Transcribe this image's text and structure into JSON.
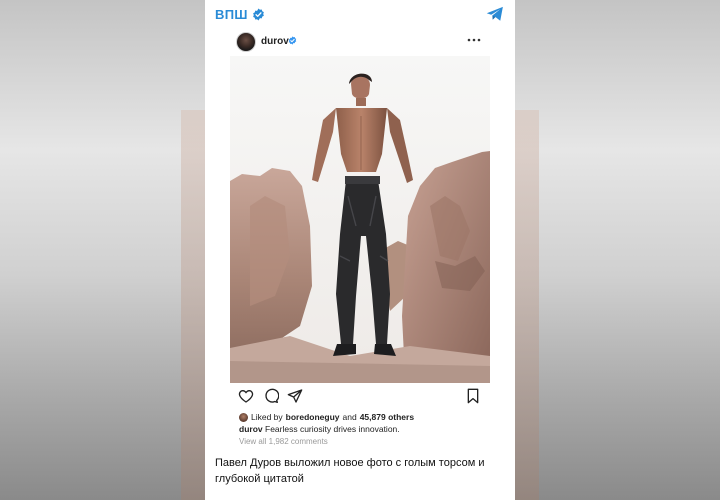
{
  "channel": {
    "name": "ВПШ"
  },
  "post": {
    "username": "durov",
    "liked_by_prefix": "Liked by",
    "liked_by_user": "boredoneguy",
    "liked_and": "and",
    "liked_count": "45,879 others",
    "caption_user": "durov",
    "caption_text": "Fearless curiosity drives innovation.",
    "comments_link": "View all 1,982 comments"
  },
  "headline": "Павел Дуров выложил новое фото с голым торсом и глубокой цитатой",
  "icons": {
    "channel_verified": "verified-badge-icon",
    "telegram": "telegram-paper-plane-icon",
    "user_verified": "verified-badge-icon",
    "more": "more-dots-icon",
    "like": "heart-icon",
    "comment": "comment-bubble-icon",
    "share": "send-icon",
    "save": "bookmark-icon"
  },
  "colors": {
    "accent": "#2a8bd6",
    "verified": "#3897f0",
    "text": "#222222",
    "muted": "#9a9a9a"
  }
}
